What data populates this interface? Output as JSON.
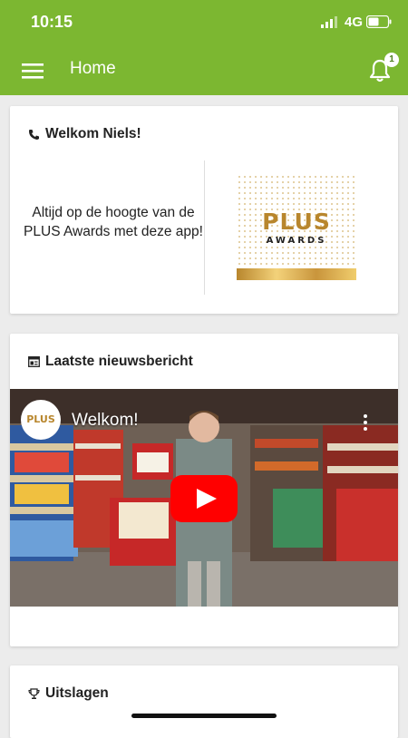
{
  "status_bar": {
    "time": "10:15",
    "network": "4G"
  },
  "toolbar": {
    "title": "Home",
    "notification_count": "1"
  },
  "welcome_card": {
    "heading": "Welkom Niels!",
    "text": "Altijd op de hoogte van de PLUS Awards met deze app!",
    "logo": {
      "main": "PLUS",
      "sub": "AWARDS"
    }
  },
  "news_card": {
    "heading": "Laatste nieuwsbericht",
    "video": {
      "title": "Welkom!",
      "channel_logo": "PLUS"
    }
  },
  "results_card": {
    "heading": "Uitslagen"
  },
  "colors": {
    "brand_green": "#7cb731",
    "youtube_red": "#ff0000",
    "gold": "#b8862d"
  },
  "icons": [
    "menu-icon",
    "bell-icon",
    "phone-icon",
    "newspaper-icon",
    "play-icon",
    "trophy-icon",
    "more-vertical-icon",
    "signal-icon",
    "battery-icon"
  ]
}
